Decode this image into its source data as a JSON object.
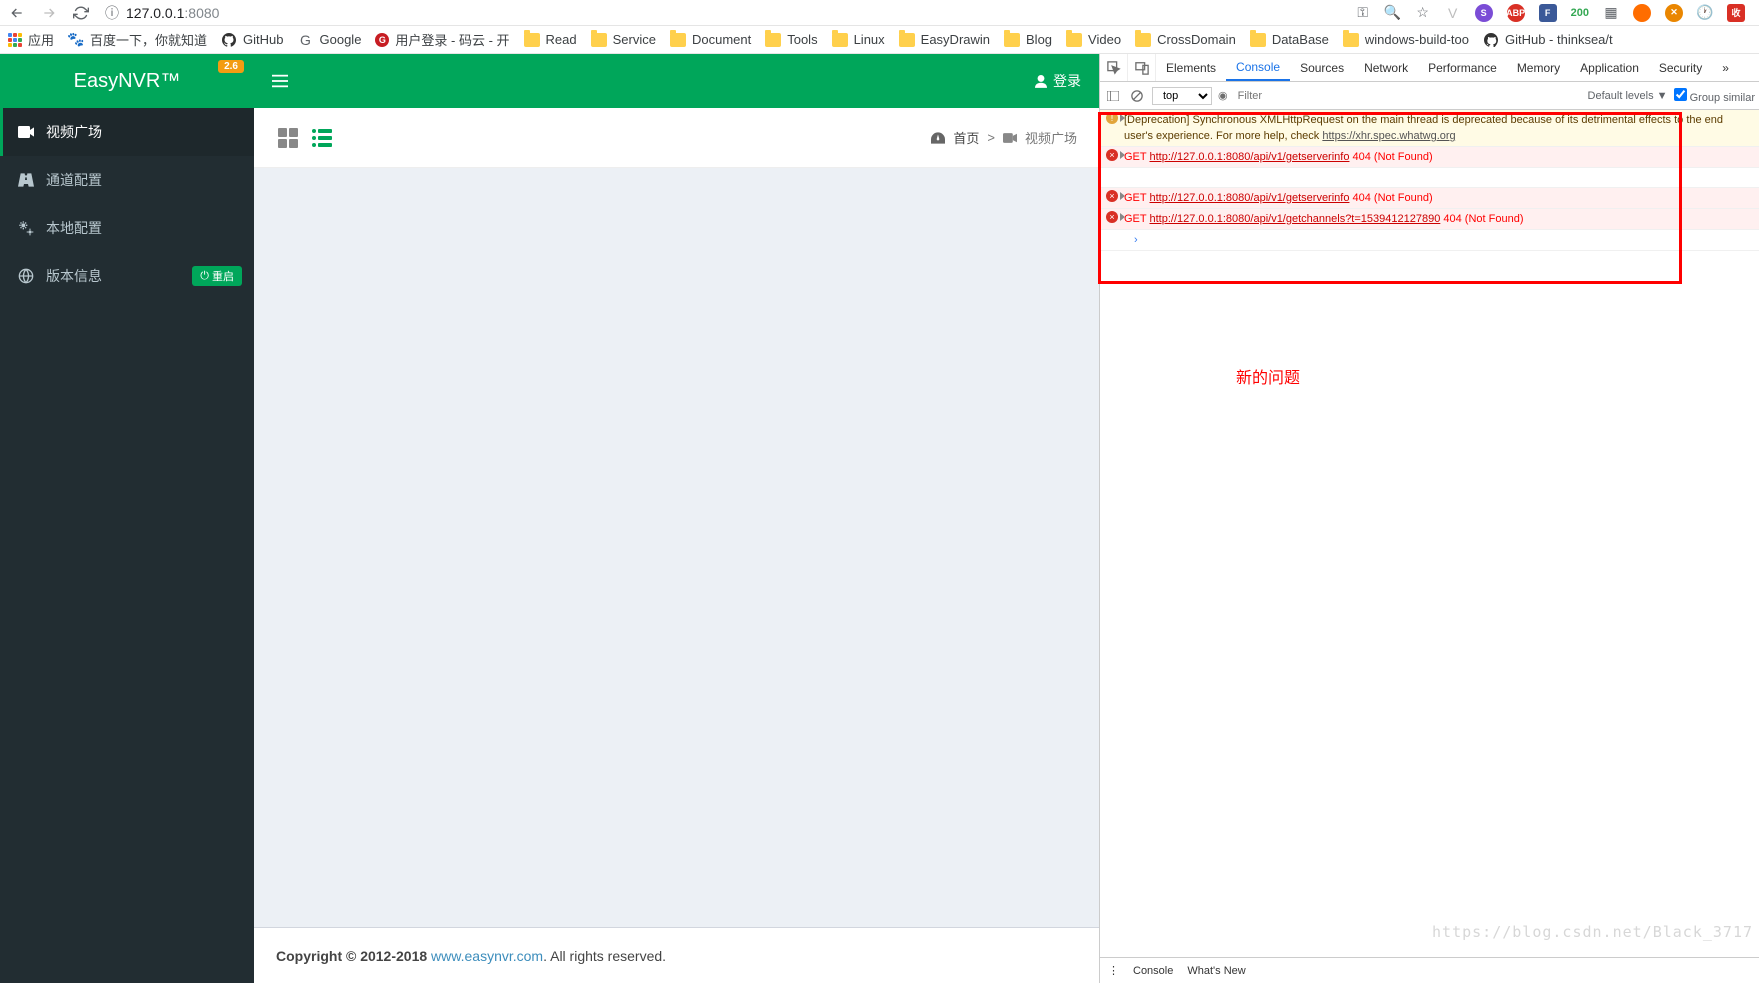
{
  "browser": {
    "url_host": "127.0.0.1",
    "url_port": ":8080",
    "ext_badge": "200"
  },
  "bookmarks": {
    "apps": "应用",
    "items": [
      "百度一下，你就知道",
      "GitHub",
      "Google",
      "用户登录 - 码云 - 开",
      "Read",
      "Service",
      "Document",
      "Tools",
      "Linux",
      "EasyDrawin",
      "Blog",
      "Video",
      "CrossDomain",
      "DataBase",
      "windows-build-too",
      "GitHub - thinksea/t"
    ]
  },
  "brand": {
    "title": "EasyNVR™",
    "badge": "2.6"
  },
  "sidebar": {
    "items": [
      {
        "icon": "video",
        "label": "视频广场"
      },
      {
        "icon": "road",
        "label": "通道配置"
      },
      {
        "icon": "cogs",
        "label": "本地配置"
      },
      {
        "icon": "globe",
        "label": "版本信息"
      }
    ],
    "restart": "重启"
  },
  "topbar": {
    "login": "登录"
  },
  "breadcrumb": {
    "home": "首页",
    "sep": ">",
    "current": "视频广场"
  },
  "footer": {
    "copyright": "Copyright © 2012-2018 ",
    "link": "www.easynvr.com",
    "suffix": ". All rights reserved."
  },
  "devtools": {
    "tabs": [
      "Elements",
      "Console",
      "Sources",
      "Network",
      "Performance",
      "Memory",
      "Application",
      "Security"
    ],
    "filter": {
      "context": "top",
      "placeholder": "Filter",
      "levels": "Default levels",
      "group": "Group similar"
    },
    "logs": {
      "warn": "[Deprecation] Synchronous XMLHttpRequest on the main thread is deprecated because of its detrimental effects to the end user's experience. For more help, check ",
      "warn_link": "https://xhr.spec.whatwg.org",
      "e1_pre": "GET ",
      "e1_url": "http://127.0.0.1:8080/api/v1/getserverinfo",
      "e1_suf": " 404 (Not Found)",
      "e2_pre": "GET ",
      "e2_url": "http://127.0.0.1:8080/api/v1/getserverinfo",
      "e2_suf": " 404 (Not Found)",
      "e3_pre": "GET ",
      "e3_url": "http://127.0.0.1:8080/api/v1/getchannels?t=1539412127890",
      "e3_suf": " 404 (Not Found)"
    },
    "bottom": {
      "console": "Console",
      "whatsnew": "What's New"
    }
  },
  "annotation": "新的问题",
  "watermark": "https://blog.csdn.net/Black_3717"
}
